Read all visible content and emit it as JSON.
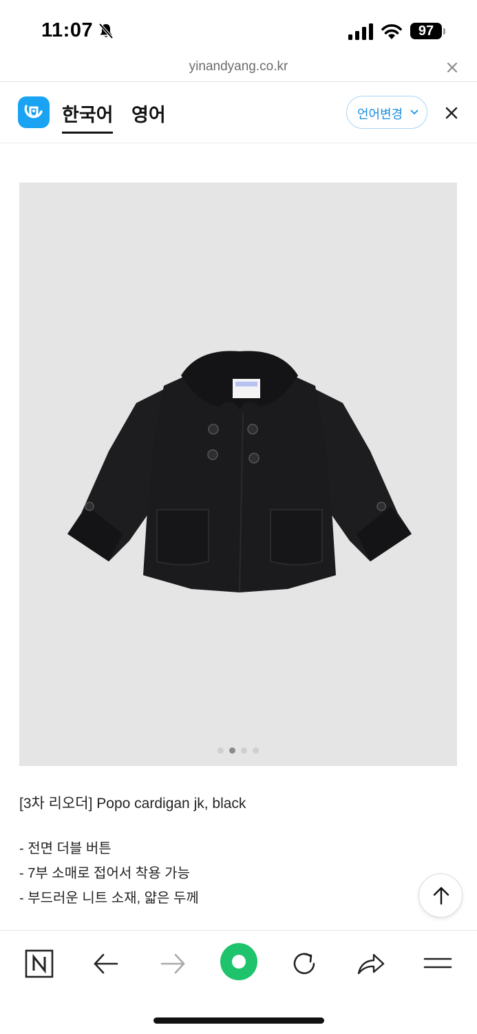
{
  "status_bar": {
    "time": "11:07",
    "battery": "97"
  },
  "browser": {
    "url": "yinandyang.co.kr"
  },
  "translate_bar": {
    "tabs": [
      {
        "label": "한국어",
        "active": true
      },
      {
        "label": "영어",
        "active": false
      }
    ],
    "language_button": "언어변경"
  },
  "product": {
    "gallery": {
      "image_count": 4,
      "active_index": 1
    },
    "title": "[3차 리오더] Popo cardigan jk, black",
    "description": [
      "- 전면 더블 버튼",
      "- 7부 소매로 접어서 착용 가능",
      "- 부드러운 니트 소재, 얇은 두께"
    ]
  },
  "colors": {
    "accent": "#1aa3f2",
    "home_green": "#1ec36b",
    "gallery_bg": "#e5e5e5"
  }
}
